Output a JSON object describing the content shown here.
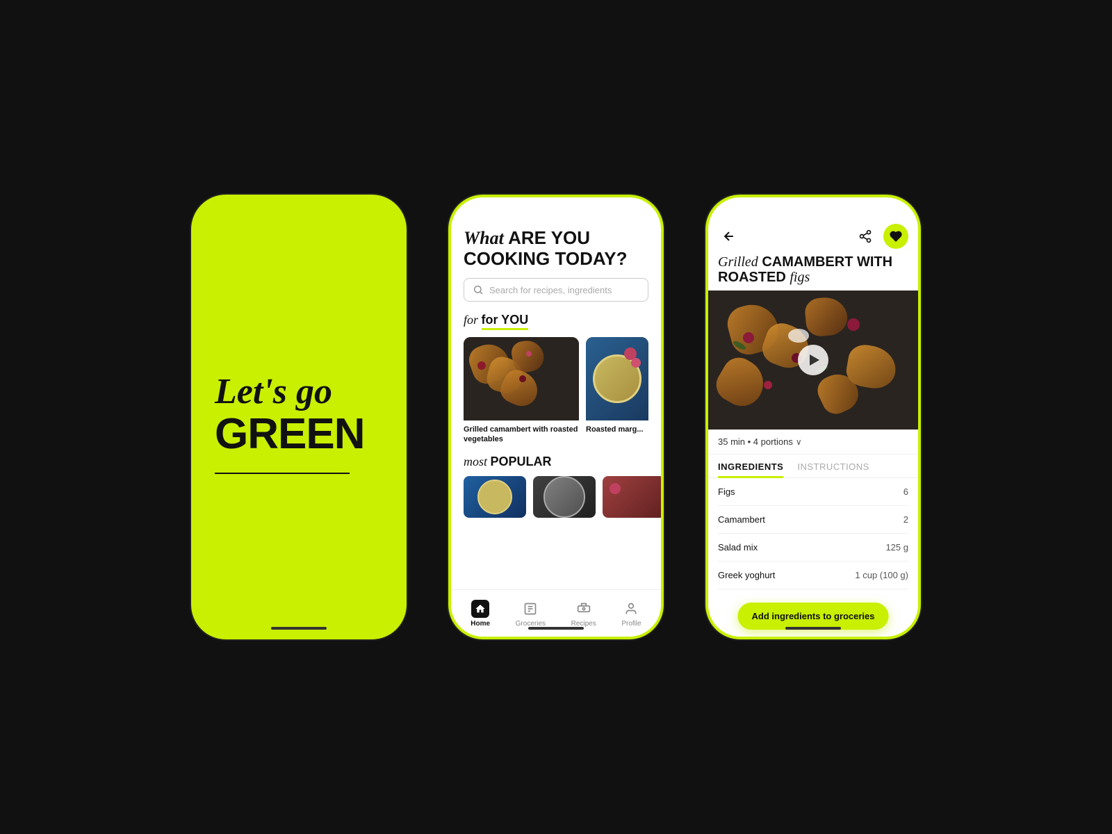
{
  "phones": {
    "splash": {
      "line1": "Let's go",
      "line2": "GREEN"
    },
    "home": {
      "heading_italic": "What",
      "heading_rest": " ARE YOU COOKING TODAY?",
      "search_placeholder": "Search for recipes, ingredients",
      "for_you_label": "for YOU",
      "most_popular_label": "most POPULAR",
      "card1_caption": "Grilled camambert with roasted vegetables",
      "card2_caption": "Roasted marg...",
      "nav_items": [
        {
          "label": "Home",
          "active": true
        },
        {
          "label": "Groceries",
          "active": false
        },
        {
          "label": "Recipes",
          "active": false
        },
        {
          "label": "Profile",
          "active": false
        }
      ]
    },
    "recipe": {
      "title_italic": "Grilled",
      "title_rest": " CAMAMBERT WITH ROASTED ",
      "title_italic2": "figs",
      "meta": "35 min • 4 portions",
      "tab_ingredients": "INGREDIENTS",
      "tab_instructions": "INSTRUCTIONS",
      "ingredients": [
        {
          "name": "Figs",
          "qty": "6"
        },
        {
          "name": "Camambert",
          "qty": "2"
        },
        {
          "name": "Salad mix",
          "qty": "125 g"
        },
        {
          "name": "Greek yoghurt",
          "qty": "1 cup (100 g)"
        }
      ],
      "add_btn": "Add ingredients to groceries"
    }
  }
}
